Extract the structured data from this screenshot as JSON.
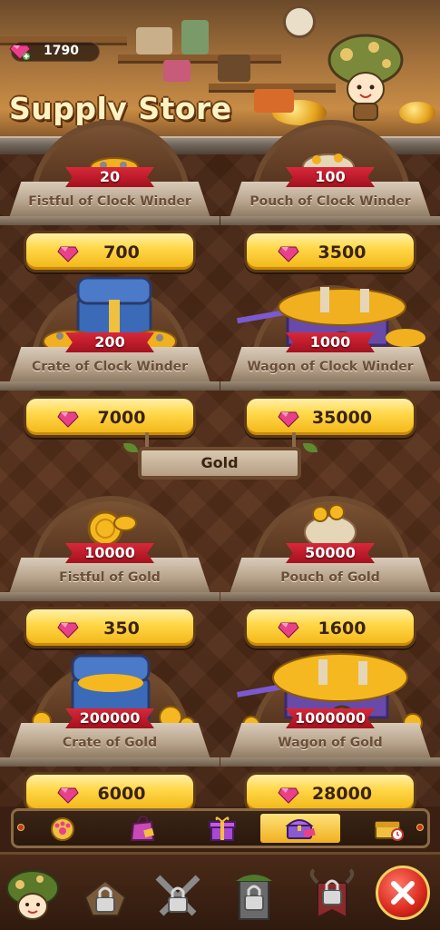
{
  "header": {
    "gem_count": "1790",
    "title": "Supply Store"
  },
  "sections": [
    {
      "label": "",
      "items": [
        {
          "name": "Fistful of Clock Winder",
          "qty": "20",
          "price": "700",
          "goods": "clock-winder-fistful"
        },
        {
          "name": "Pouch of Clock Winder",
          "qty": "100",
          "price": "3500",
          "goods": "clock-winder-pouch"
        },
        {
          "name": "Crate of Clock Winder",
          "qty": "200",
          "price": "7000",
          "goods": "clock-winder-crate"
        },
        {
          "name": "Wagon of Clock Winder",
          "qty": "1000",
          "price": "35000",
          "goods": "clock-winder-wagon"
        }
      ]
    },
    {
      "label": "Gold",
      "items": [
        {
          "name": "Fistful of Gold",
          "qty": "10000",
          "price": "350",
          "goods": "gold-fistful"
        },
        {
          "name": "Pouch of Gold",
          "qty": "50000",
          "price": "1600",
          "goods": "gold-pouch"
        },
        {
          "name": "Crate of Gold",
          "qty": "200000",
          "price": "6000",
          "goods": "gold-crate"
        },
        {
          "name": "Wagon of Gold",
          "qty": "1000000",
          "price": "28000",
          "goods": "gold-wagon"
        }
      ]
    }
  ],
  "tabs": [
    {
      "icon": "paw-medal-icon",
      "active": false
    },
    {
      "icon": "shopping-bag-icon",
      "active": false
    },
    {
      "icon": "gift-box-icon",
      "active": false
    },
    {
      "icon": "treasure-chest-icon",
      "active": true
    },
    {
      "icon": "timed-chest-icon",
      "active": false
    }
  ],
  "bottom_nav": [
    {
      "icon": "mushroom-hero-icon",
      "locked": false
    },
    {
      "icon": "locked-paw-icon",
      "locked": true
    },
    {
      "icon": "locked-swords-icon",
      "locked": true
    },
    {
      "icon": "locked-tower-icon",
      "locked": true
    },
    {
      "icon": "locked-horns-banner-icon",
      "locked": true
    },
    {
      "icon": "close-icon",
      "locked": false
    }
  ],
  "colors": {
    "price_button": "#ffd84a",
    "ribbon": "#c81e2e",
    "gem": "#e8418a",
    "close": "#d8281c"
  }
}
